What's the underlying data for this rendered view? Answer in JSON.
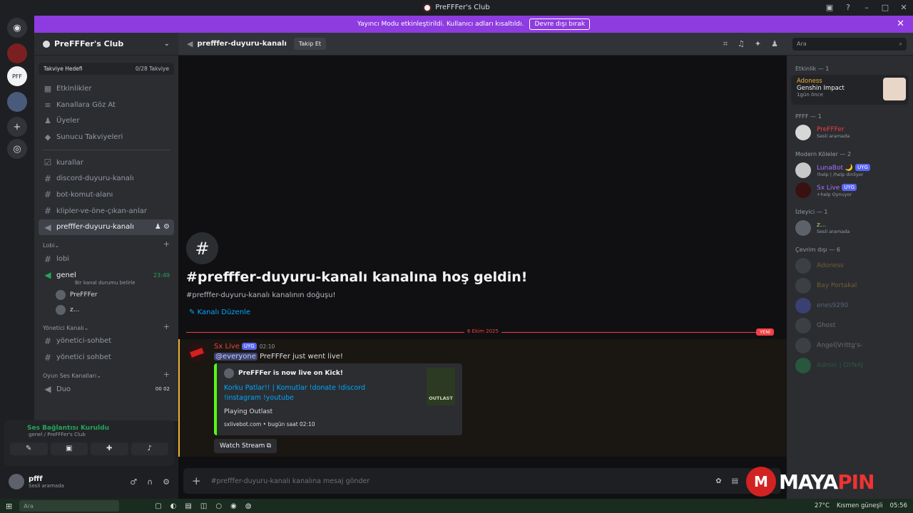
{
  "window": {
    "title": "PreFFFer's Club"
  },
  "notice": {
    "text": "Yayıncı Modu etkinleştirildi. Kullanıcı adları kısaltıldı.",
    "button": "Devre dışı bırak"
  },
  "server": {
    "name": "PreFFFer's Club",
    "boost_label": "Takviye Hedefi",
    "boost_count": "0/28 Takviye"
  },
  "nav": [
    {
      "label": "Etkinlikler"
    },
    {
      "label": "Kanallara Göz At"
    },
    {
      "label": "Üyeler"
    },
    {
      "label": "Sunucu Takviyeleri"
    }
  ],
  "channels": [
    {
      "label": "kurallar"
    },
    {
      "label": "discord-duyuru-kanalı"
    },
    {
      "label": "bot-komut-alanı"
    },
    {
      "label": "klipler-ve-öne-çıkan-anlar"
    },
    {
      "label": "prefffer-duyuru-kanalı"
    }
  ],
  "lobby": {
    "category": "Lobi",
    "lobi": "lobi",
    "genel": "genel",
    "genel_time": "23:49",
    "genel_status": "Bir kanal durumu belirle",
    "users": [
      {
        "name": "PreFFFer"
      },
      {
        "name": "z..."
      }
    ]
  },
  "admin": {
    "category": "Yönetici Kanalı",
    "channels": [
      {
        "label": "yönetici-sohbet"
      },
      {
        "label": "yönetici sohbet"
      }
    ]
  },
  "game_voice": {
    "category": "Oyun Ses Kanalları",
    "duo": "Duo",
    "duo_count_a": "00",
    "duo_count_b": "02"
  },
  "voice_panel": {
    "status": "Ses Bağlantısı Kuruldu",
    "location": "genel / PreFFFer's Club"
  },
  "user": {
    "name": "pfff",
    "status": "Sesli aramada"
  },
  "chat_header": {
    "channel": "prefffer-duyuru-kanalı",
    "follow": "Takip Et"
  },
  "search": {
    "placeholder": "Ara"
  },
  "welcome": {
    "title": "#prefffer-duyuru-kanalı kanalına hoş geldin!",
    "subtitle": "#prefffer-duyuru-kanalı kanalının doğuşu!",
    "edit": "Kanalı Düzenle"
  },
  "divider": {
    "date": "6 Ekim 2025",
    "new": "YENİ"
  },
  "message": {
    "author": "Sx Live",
    "badge": "UYG",
    "time": "02:10",
    "mention": "@everyone",
    "text": "PreFFFer just went live!",
    "embed_author": "PreFFFer is now live on Kick!",
    "embed_title": "Korku Patlar!! | Komutlar !donate !discord !instagram !youtube",
    "embed_desc": "Playing Outlast",
    "embed_footer": "sxlivebot.com • bugün saat 02:10",
    "thumb_label": "OUTLAST",
    "watch": "Watch Stream"
  },
  "composer": {
    "placeholder": "#prefffer-duyuru-kanalı kanalına mesaj gönder"
  },
  "members": {
    "activity_head": "Etkinlik — 1",
    "activity_user": "Adoness",
    "activity_game": "Genshin Impact",
    "activity_time": "1gün önce",
    "pfff_head": "PFFF — 1",
    "pfff_user": "PreFFFer",
    "pfff_sub": "Sesli aramada",
    "modern_head": "Modern Köleler — 2",
    "luna": "LunaBot 🌙",
    "luna_sub": "!help | /help dinliyor",
    "sx": "Sx Live",
    "sx_sub": "+help Oynuyor",
    "izleyici_head": "İzleyici — 1",
    "z": "z...",
    "z_sub": "Sesli aramada",
    "offline_head": "Çevrim dışı — 6",
    "offline": [
      "Adoness",
      "Bay Portakal",
      "enes9290",
      "Ghost",
      "Angel|Vrittg's-",
      "Admin | DYNAJ"
    ]
  },
  "taskbar": {
    "search": "Ara",
    "weather": "27°C",
    "weather_desc": "Kısmen güneşli",
    "clock": "05:56"
  },
  "watermark": {
    "text_a": "MAYA",
    "text_b": "PIN"
  }
}
